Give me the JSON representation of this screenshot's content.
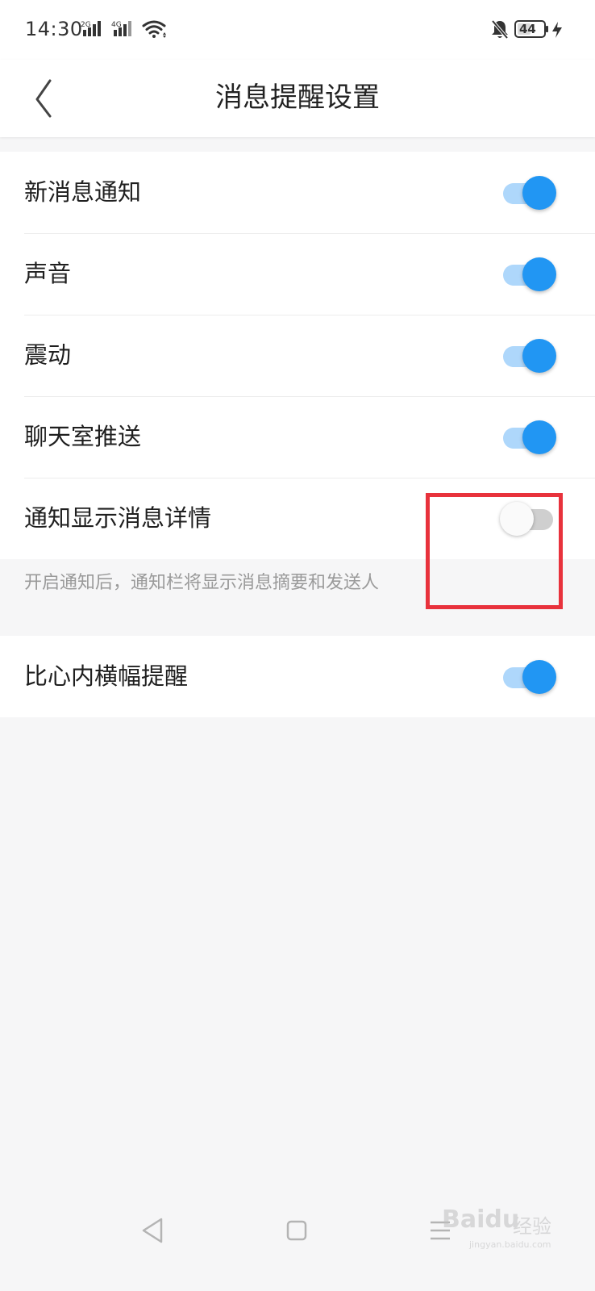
{
  "status_bar": {
    "time": "14:30",
    "network_1": "2G",
    "network_2": "4G",
    "battery": "44",
    "icons": [
      "signal-icon",
      "wifi-icon",
      "bell-muted-icon",
      "battery-icon",
      "charging-icon"
    ]
  },
  "header": {
    "title": "消息提醒设置",
    "back_icon": "back-arrow-icon"
  },
  "settings": [
    {
      "label": "新消息通知",
      "enabled": true
    },
    {
      "label": "声音",
      "enabled": true
    },
    {
      "label": "震动",
      "enabled": true
    },
    {
      "label": "聊天室推送",
      "enabled": true
    },
    {
      "label": "通知显示消息详情",
      "enabled": false
    }
  ],
  "hint": "开启通知后，通知栏将显示消息摘要和发送人",
  "banner_setting": {
    "label": "比心内横幅提醒",
    "enabled": true
  },
  "annotation": {
    "color": "#e8323c"
  },
  "colors": {
    "switch_on_thumb": "#2196f3",
    "switch_on_track": "#aed7fb",
    "switch_off_track": "#cfcfcf",
    "page_background": "#f6f6f7"
  },
  "nav_bar": {
    "icons": [
      "nav-back-icon",
      "nav-home-icon",
      "nav-menu-icon"
    ]
  },
  "watermark": {
    "main": "Baidu",
    "cn": "经验",
    "sub": "jingyan.baidu.com"
  }
}
